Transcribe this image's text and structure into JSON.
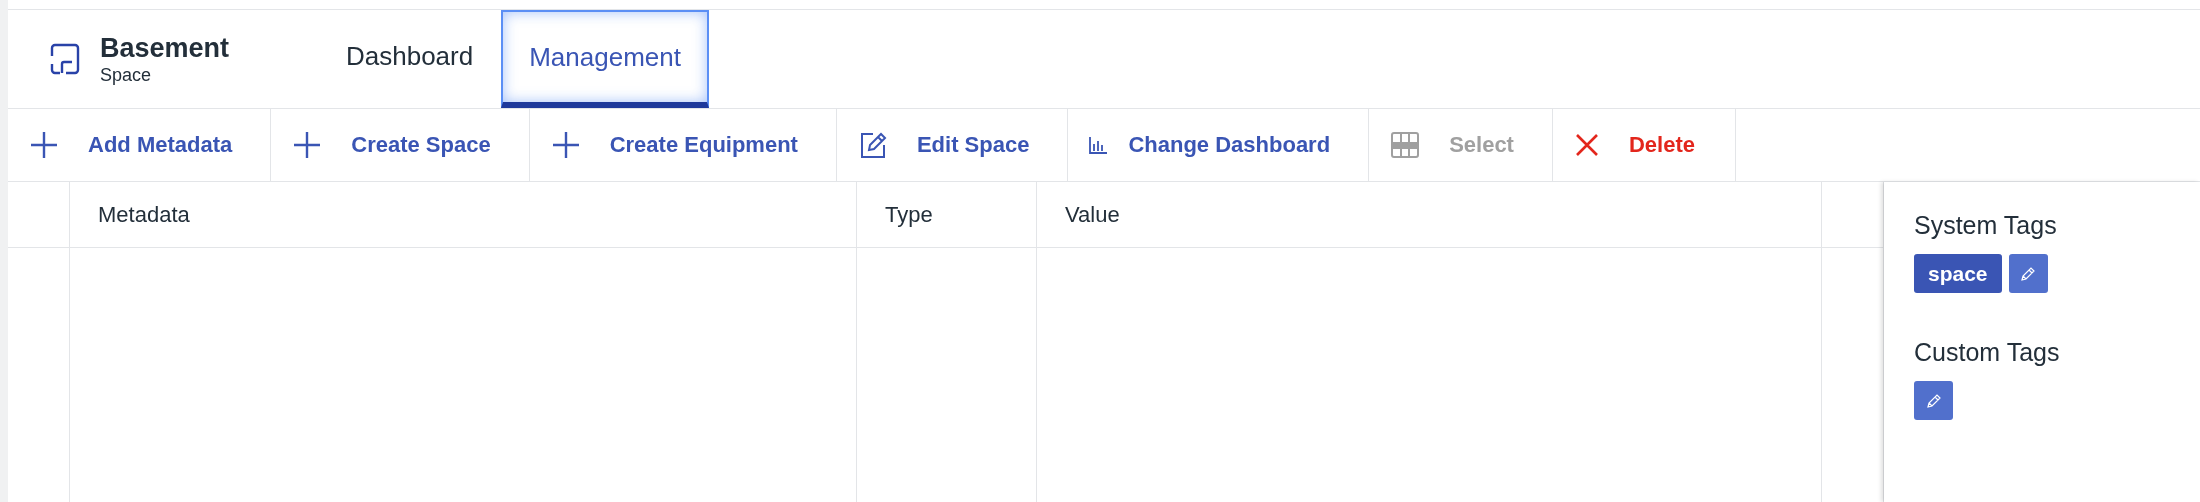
{
  "header": {
    "title": "Basement",
    "subtitle": "Space"
  },
  "tabs": [
    {
      "label": "Dashboard",
      "selected": false
    },
    {
      "label": "Management",
      "selected": true
    }
  ],
  "toolbar": [
    {
      "kind": "add",
      "label": "Add Metadata",
      "disabled": false
    },
    {
      "kind": "add",
      "label": "Create Space",
      "disabled": false
    },
    {
      "kind": "add",
      "label": "Create Equipment",
      "disabled": false
    },
    {
      "kind": "edit",
      "label": "Edit Space",
      "disabled": false
    },
    {
      "kind": "chart",
      "label": "Change Dashboard",
      "disabled": false
    },
    {
      "kind": "select",
      "label": "Select",
      "disabled": true
    },
    {
      "kind": "delete",
      "label": "Delete",
      "disabled": false
    }
  ],
  "table": {
    "columns": [
      "Metadata",
      "Type",
      "Value"
    ]
  },
  "tags_panel": {
    "sections": [
      {
        "title": "System Tags",
        "tags": [
          "space"
        ]
      },
      {
        "title": "Custom Tags"
      }
    ]
  }
}
